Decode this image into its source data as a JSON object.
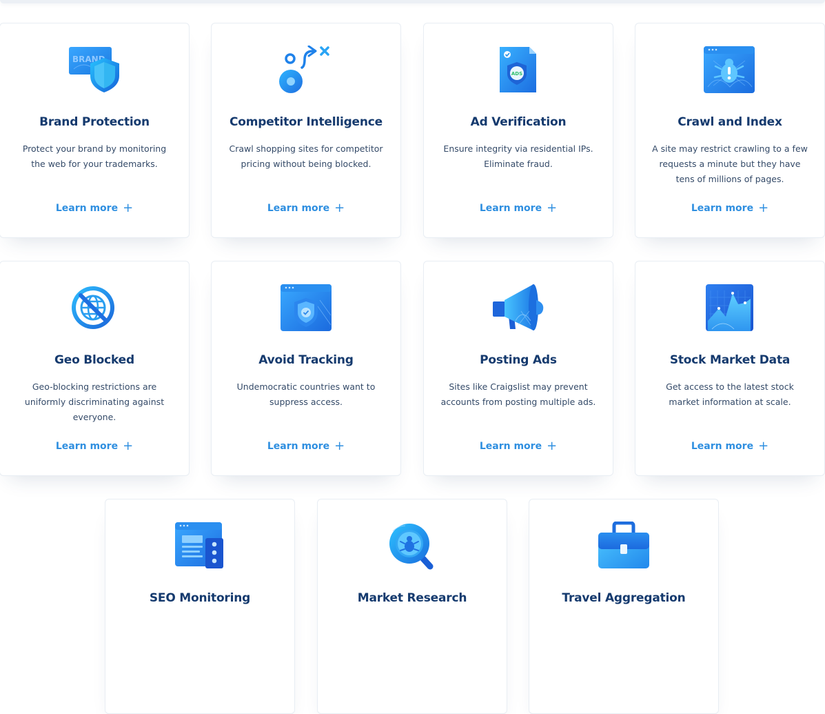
{
  "cards": [
    {
      "title": "Brand Protection",
      "description": "Protect your brand by monitoring the web for your trademarks.",
      "link": "Learn more",
      "icon": "brand-shield-icon"
    },
    {
      "title": "Competitor Intelligence",
      "description": "Crawl shopping sites for competitor pricing without being blocked.",
      "link": "Learn more",
      "icon": "competitor-route-icon"
    },
    {
      "title": "Ad Verification",
      "description": "Ensure integrity via residential IPs. Eliminate fraud.",
      "link": "Learn more",
      "icon": "ads-document-icon",
      "icon_text": "ADS"
    },
    {
      "title": "Crawl and Index",
      "description": "A site may restrict crawling to a few requests a minute but they have tens of millions of pages.",
      "link": "Learn more",
      "icon": "crawler-bug-icon"
    },
    {
      "title": "Geo Blocked",
      "description": "Geo-blocking restrictions are uniformly discriminating against everyone.",
      "link": "Learn more",
      "icon": "blocked-globe-icon"
    },
    {
      "title": "Avoid Tracking",
      "description": "Undemocratic countries want to suppress access.",
      "link": "Learn more",
      "icon": "tracking-shield-icon"
    },
    {
      "title": "Posting Ads",
      "description": "Sites like Craigslist may prevent accounts from posting multiple ads.",
      "link": "Learn more",
      "icon": "megaphone-icon"
    },
    {
      "title": "Stock Market Data",
      "description": "Get access to the latest stock market information at scale.",
      "link": "Learn more",
      "icon": "stock-chart-icon"
    },
    {
      "title": "SEO Monitoring",
      "description": "",
      "link": "",
      "icon": "seo-browser-icon"
    },
    {
      "title": "Market Research",
      "description": "",
      "link": "",
      "icon": "magnifier-bug-icon"
    },
    {
      "title": "Travel Aggregation",
      "description": "",
      "link": "",
      "icon": "briefcase-icon"
    }
  ],
  "brand_icon_text": "BRAND",
  "colors": {
    "title": "#153a6e",
    "link": "#2f8fe0",
    "icon_primary": "#1f8de8",
    "icon_dark": "#1e64d6"
  }
}
